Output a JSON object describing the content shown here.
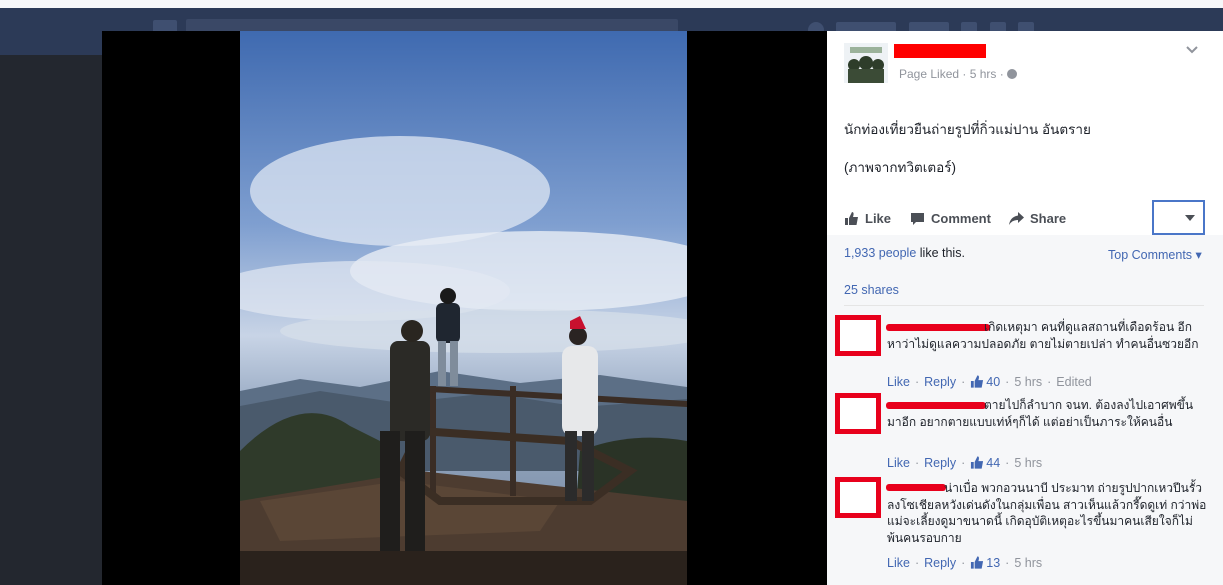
{
  "post": {
    "meta_text": "Page Liked · 5 hrs ·",
    "text_line1": "นักท่องเที่ยวยืนถ่ายรูปที่กิ่วแม่ปาน อันตราย",
    "text_line2": "(ภาพจากทวิตเตอร์)"
  },
  "actions": {
    "like_label": "Like",
    "comment_label": "Comment",
    "share_label": "Share"
  },
  "ufi": {
    "likes_count_link": "1,933 people",
    "likes_suffix": " like this.",
    "top_comments_label": "Top Comments ▾",
    "shares_label": "25 shares"
  },
  "comments": [
    {
      "text": "เกิดเหตุมา คนที่ดูแลสถานที่เดือดร้อน อีก หาว่าไม่ดูแลความปลอดภัย ตายไม่ตายเปล่า ทำคนอื่นซวยอีก",
      "like_label": "Like",
      "reply_label": "Reply",
      "likes": "40",
      "time": "5 hrs",
      "edited": "Edited"
    },
    {
      "text": "ตายไปก็ลำบาก จนท. ต้องลงไปเอาศพขึ้นมาอีก อยากตายแบบเท่ห์ๆก็ได้ แต่อย่าเป็นภาระให้คนอื่น",
      "like_label": "Like",
      "reply_label": "Reply",
      "likes": "44",
      "time": "5 hrs"
    },
    {
      "text": "น่าเบื่อ พวกอวนนาบี ประมาท ถ่ายรูปปากเหวปีนรั้วลงโซเชียลหวังเด่นดังในกลุ่มเพื่อน สาวเห็นแล้วกรี๊ดดูเท่ กว่าพ่อแม่จะเลี้ยงดูมาขนาดนี้ เกิดอุบัติเหตุอะไรขึ้นมาคนเสียใจก็ไม่พ้นคนรอบกาย",
      "like_label": "Like",
      "reply_label": "Reply",
      "likes": "13",
      "time": "5 hrs"
    }
  ],
  "colors": {
    "link": "#4267b2",
    "redaction": "#e8001c",
    "fb_bar": "#2c3a57"
  },
  "icons": [
    "thumbs-up-icon",
    "comment-bubble-icon",
    "share-arrow-icon",
    "globe-icon",
    "chevron-down-icon"
  ]
}
